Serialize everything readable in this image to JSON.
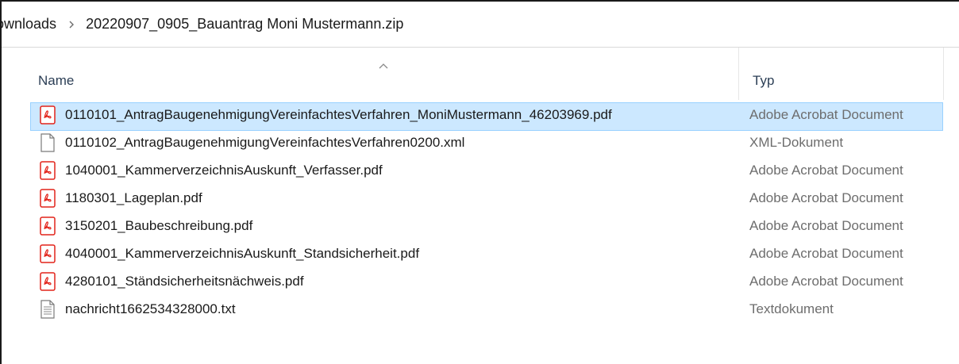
{
  "breadcrumb": {
    "items": [
      {
        "label": "ownloads"
      },
      {
        "label": "20220907_0905_Bauantrag Moni Mustermann.zip"
      }
    ]
  },
  "columns": {
    "name": "Name",
    "type": "Typ"
  },
  "files": [
    {
      "name": "0110101_AntragBaugenehmigungVereinfachtesVerfahren_MoniMustermann_46203969.pdf",
      "type": "Adobe Acrobat Document",
      "icon": "pdf-icon",
      "selected": true
    },
    {
      "name": "0110102_AntragBaugenehmigungVereinfachtesVerfahren0200.xml",
      "type": "XML-Dokument",
      "icon": "blank-file-icon",
      "selected": false
    },
    {
      "name": "1040001_KammerverzeichnisAuskunft_Verfasser.pdf",
      "type": "Adobe Acrobat Document",
      "icon": "pdf-icon",
      "selected": false
    },
    {
      "name": "1180301_Lageplan.pdf",
      "type": "Adobe Acrobat Document",
      "icon": "pdf-icon",
      "selected": false
    },
    {
      "name": "3150201_Baubeschreibung.pdf",
      "type": "Adobe Acrobat Document",
      "icon": "pdf-icon",
      "selected": false
    },
    {
      "name": "4040001_KammerverzeichnisAuskunft_Standsicherheit.pdf",
      "type": "Adobe Acrobat Document",
      "icon": "pdf-icon",
      "selected": false
    },
    {
      "name": "4280101_Ständsicherheitsnächweis.pdf",
      "type": "Adobe Acrobat Document",
      "icon": "pdf-icon",
      "selected": false
    },
    {
      "name": "nachricht1662534328000.txt",
      "type": "Textdokument",
      "icon": "text-file-icon",
      "selected": false
    }
  ],
  "colors": {
    "selection_bg": "#cce8ff",
    "selection_border": "#99d1ff",
    "pdf_red": "#e2231a",
    "header_text": "#2b3e55",
    "type_text": "#6d6d6d"
  }
}
